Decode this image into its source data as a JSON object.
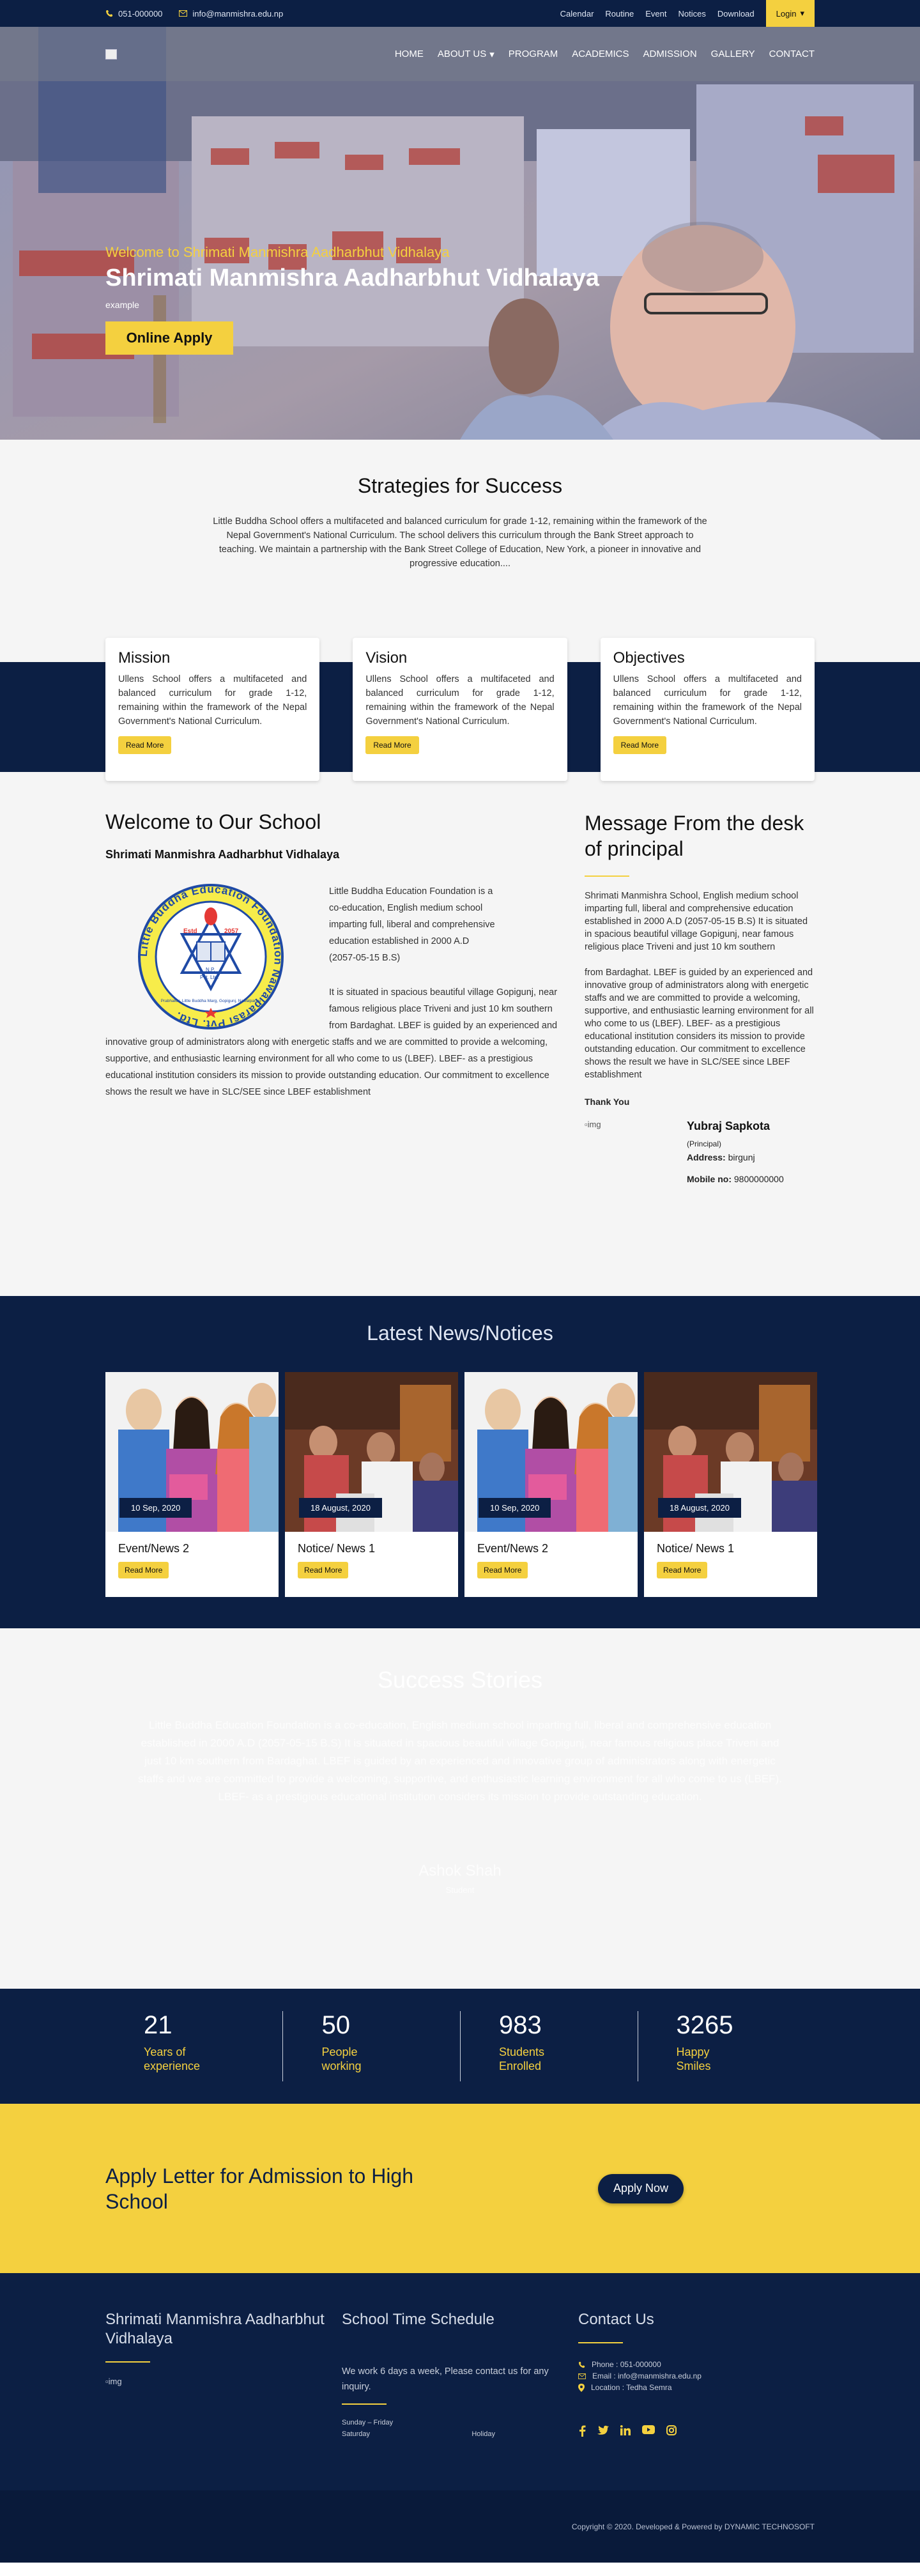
{
  "topbar": {
    "phone": "051-000000",
    "email": "info@manmishra.edu.np",
    "links": [
      "Calendar",
      "Routine",
      "Event",
      "Notices",
      "Download"
    ],
    "login": "Login"
  },
  "nav": {
    "items": [
      "HOME",
      "ABOUT US",
      "PROGRAM",
      "ACADEMICS",
      "ADMISSION",
      "GALLERY",
      "CONTACT"
    ]
  },
  "hero": {
    "welcome": "Welcome to Shrimati Manmishra Aadharbhut Vidhalaya",
    "title": "Shrimati Manmishra Aadharbhut Vidhalaya",
    "subtitle": "example",
    "button": "Online Apply"
  },
  "strategies": {
    "title": "Strategies for Success",
    "text": "Little Buddha School offers a multifaceted and balanced curriculum for grade 1-12, remaining within the framework of the Nepal Government's National Curriculum. The school delivers this curriculum through the Bank Street approach to teaching. We maintain a partnership with the Bank Street College of Education, New York, a pioneer in innovative and progressive education...."
  },
  "cards": [
    {
      "title": "Mission",
      "text": "Ullens School offers a multifaceted and balanced curriculum for grade 1-12, remaining within the framework of the Nepal Government's National Curriculum.",
      "button": "Read More"
    },
    {
      "title": "Vision",
      "text": "Ullens School offers a multifaceted and balanced curriculum for grade 1-12, remaining within the framework of the Nepal Government's National Curriculum.",
      "button": "Read More"
    },
    {
      "title": "Objectives",
      "text": "Ullens School offers a multifaceted and balanced curriculum for grade 1-12, remaining within the framework of the Nepal Government's National Curriculum.",
      "button": "Read More"
    }
  ],
  "welcome": {
    "title": "Welcome to Our School",
    "subtitle": "Shrimati Manmishra Aadharbhut Vidhalaya",
    "p1": "Little Buddha Education Foundation is a co-education, English medium school imparting full, liberal and comprehensive education established in 2000 A.D (2057-05-15 B.S)",
    "p2": "It is situated in spacious beautiful village Gopigunj, near famous religious place Triveni and just 10 km southern from Bardaghat. LBEF is guided by an experienced and innovative group of administrators along with energetic staffs and we are committed to provide a welcoming, supportive, and enthusiastic learning environment for all who come to us (LBEF). LBEF- as a prestigious educational institution considers its mission to provide outstanding education. Our commitment to excellence shows the result we have in SLC/SEE since LBEF establishment",
    "logo": {
      "ring_text": "Little Buddha Education Foundation Nawalparasi Pvt. Ltd.",
      "inner_bottom": "Prabhakar, Little Buddha Marg, Gopigunj, Nawalparasi",
      "estd": "Estd",
      "year": "2057",
      "np": "N.P.",
      "pvt": "Pvt. Ltd."
    }
  },
  "principal": {
    "title": "Message From the desk of principal",
    "p1": "Shrimati Manmishra School, English medium school imparting full, liberal and comprehensive education established in 2000 A.D (2057-05-15 B.S) It is situated in spacious beautiful village Gopigunj, near famous religious place Triveni and just 10 km southern",
    "p2": "from Bardaghat. LBEF is guided by an experienced and innovative group of administrators along with energetic staffs and we are committed to provide a welcoming, supportive, and enthusiastic learning environment for all who come to us (LBEF). LBEF- as a prestigious educational institution considers its mission to provide outstanding education. Our commitment to excellence shows the result we have in SLC/SEE since LBEF establishment",
    "thanks": "Thank You",
    "img_alt": "img",
    "name": "Yubraj Sapkota",
    "role": "(Principal)",
    "address_label": "Address:",
    "address": "birgunj",
    "mobile_label": "Mobile no:",
    "mobile": "9800000000"
  },
  "news": {
    "title": "Latest News/Notices",
    "items": [
      {
        "date": "10 Sep, 2020",
        "title": "Event/News 2",
        "button": "Read More"
      },
      {
        "date": "18 August, 2020",
        "title": "Notice/ News 1",
        "button": "Read More"
      },
      {
        "date": "10 Sep, 2020",
        "title": "Event/News 2",
        "button": "Read More"
      },
      {
        "date": "18 August, 2020",
        "title": "Notice/ News 1",
        "button": "Read More"
      }
    ]
  },
  "success": {
    "title": "Success Stories",
    "text": "Little Buddha Education Foundation is a co-education, English medium school imparting full, liberal and comprehensive education established in 2000 A.D (2057-05-15 B.S) It is situated in spacious beautiful village Gopigunj, near famous religious place Triveni and just 10 km southern from Bardaghat. LBEF is guided by an experienced and innovative group of administrators along with energetic staffs and we are committed to provide a welcoming, supportive, and enthusiastic learning environment for all who come to us (LBEF). LBEF- as a prestigious educational institution considers its mission to provide outstanding education.",
    "name": "Ashok Shah",
    "role": "Student"
  },
  "stats": [
    {
      "num": "21",
      "label": "Years of experience"
    },
    {
      "num": "50",
      "label": "People working"
    },
    {
      "num": "983",
      "label": "Students Enrolled"
    },
    {
      "num": "3265",
      "label": "Happy Smiles"
    }
  ],
  "admission": {
    "title": "Apply Letter for Admission to High School",
    "button": "Apply Now"
  },
  "footer": {
    "school_title": "Shrimati Manmishra Aadharbhut Vidhalaya",
    "img_alt": "img",
    "schedule_title": "School Time Schedule",
    "schedule_text": "We work 6 days a week, Please contact us for any inquiry.",
    "days": "Sunday – Friday",
    "sat": "Saturday",
    "holiday": "Holiday",
    "contact_title": "Contact Us",
    "phone": "Phone : 051-000000",
    "email": "Email : info@manmishra.edu.np",
    "location": "Location : Tedha Semra",
    "copyright": "Copyright © 2020. Developed & Powered by DYNAMIC TECHNOSOFT"
  },
  "colors": {
    "navy": "#0c1f44",
    "accent": "#f4d03f",
    "light_bg": "#f5f5f5"
  }
}
